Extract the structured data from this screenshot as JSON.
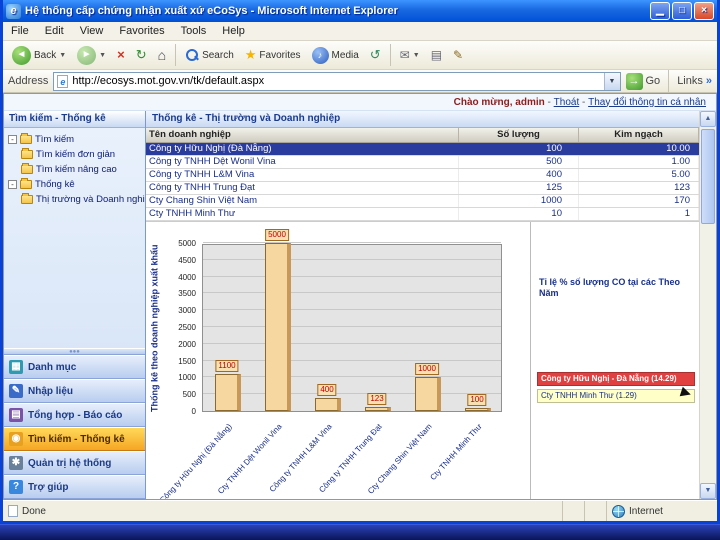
{
  "titlebar": {
    "title": "Hệ thống cấp chứng nhận xuất xứ eCoSys - Microsoft Internet Explorer"
  },
  "menubar": {
    "items": [
      "File",
      "Edit",
      "View",
      "Favorites",
      "Tools",
      "Help"
    ]
  },
  "toolbar": {
    "back_label": "Back",
    "search_label": "Search",
    "favorites_label": "Favorites",
    "media_label": "Media"
  },
  "addressbar": {
    "label": "Address",
    "url": "http://ecosys.mot.gov.vn/tk/default.aspx",
    "go_label": "Go",
    "links_label": "Links",
    "links_chevron": "»"
  },
  "greeting": {
    "welcome": "Chào mừng, admin",
    "sep1": " - ",
    "logout": "Thoát",
    "sep2": " - ",
    "change_info": "Thay đổi thông tin cá nhân"
  },
  "sidebar": {
    "header": "Tìm kiếm - Thống kê",
    "tree": [
      {
        "label": "Tìm kiếm",
        "level": 0
      },
      {
        "label": "Tìm kiếm đơn giản",
        "level": 1
      },
      {
        "label": "Tìm kiếm nâng cao",
        "level": 1
      },
      {
        "label": "Thống kê",
        "level": 0
      },
      {
        "label": "Thị trường và Doanh nghiệp",
        "level": 1
      }
    ],
    "nav": [
      {
        "label": "Danh mục",
        "icon": "catalog-icon",
        "active": false
      },
      {
        "label": "Nhập liệu",
        "icon": "input-icon",
        "active": false
      },
      {
        "label": "Tổng hợp - Báo cáo",
        "icon": "report-icon",
        "active": false
      },
      {
        "label": "Tìm kiếm - Thống kê",
        "icon": "search-stats-icon",
        "active": true
      },
      {
        "label": "Quản trị hệ thống",
        "icon": "admin-icon",
        "active": false
      },
      {
        "label": "Trợ giúp",
        "icon": "help-icon",
        "active": false
      }
    ]
  },
  "main": {
    "header": "Thống kê - Thị trường và Doanh nghiệp",
    "table": {
      "columns": [
        "Tên doanh nghiệp",
        "Số lượng",
        "Kim ngạch"
      ],
      "rows": [
        {
          "name": "Công ty Hữu Nghị (Đà Nẵng)",
          "quantity": "100",
          "value": "10.00",
          "selected": true
        },
        {
          "name": "Công ty TNHH Dệt Wonil Vina",
          "quantity": "500",
          "value": "1.00",
          "selected": false
        },
        {
          "name": "Công ty TNHH L&M Vina",
          "quantity": "400",
          "value": "5.00",
          "selected": false
        },
        {
          "name": "Công ty TNHH Trung Đạt",
          "quantity": "125",
          "value": "123",
          "selected": false
        },
        {
          "name": "Cty Chang Shin Việt Nam",
          "quantity": "1000",
          "value": "170",
          "selected": false
        },
        {
          "name": "Cty TNHH Minh Thư",
          "quantity": "10",
          "value": "1",
          "selected": false
        }
      ]
    }
  },
  "chart_data": {
    "type": "bar",
    "title": "",
    "ylabel": "Thống kê theo doanh nghiệp xuất khẩu",
    "xlabel": "",
    "categories": [
      "Công ty Hữu Nghị (Đà Nẵng)",
      "Cty TNHH Dệt Wonil Vina",
      "Công ty TNHH L&M Vina",
      "Công ty TNHH Trung Đạt",
      "Cty Chang Shin Việt Nam",
      "Cty TNHH Minh Thư"
    ],
    "values": [
      1100,
      5000,
      400,
      123,
      1000,
      100
    ],
    "ylim": [
      0,
      5000
    ],
    "ytick_step": 500,
    "grid": true,
    "bar_color": "#F6D7A0",
    "legend_position": "right"
  },
  "right_panel": {
    "title": "Tỉ lệ % số lượng CO tại các Theo Năm",
    "legend": [
      {
        "label": "Công ty Hữu Nghị - Đà Nẵng (14.29)",
        "color": "#E04040",
        "highlight": true
      },
      {
        "label": "Cty TNHH Minh Thư (1.29)",
        "color": "#FFFFC8",
        "highlight": false
      }
    ]
  },
  "statusbar": {
    "left": "Done",
    "right": "Internet"
  }
}
